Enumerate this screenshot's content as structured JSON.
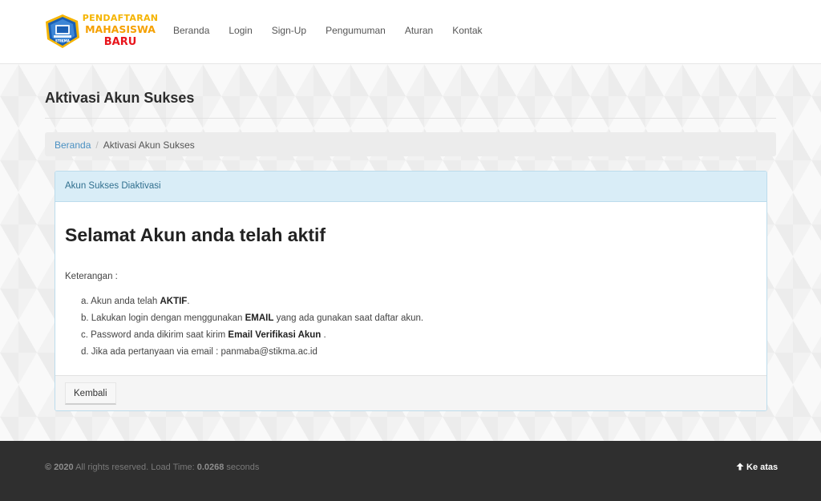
{
  "header": {
    "logo": {
      "line1": "PENDAFTARAN",
      "line2": "MAHASISWA",
      "line3": "BARU",
      "emblem_text": "STIKMA",
      "colors": {
        "gold": "#f5b400",
        "red": "#e8141b",
        "blue": "#1a5fb4"
      }
    },
    "nav": [
      {
        "label": "Beranda"
      },
      {
        "label": "Login"
      },
      {
        "label": "Sign-Up"
      },
      {
        "label": "Pengumuman"
      },
      {
        "label": "Aturan"
      },
      {
        "label": "Kontak"
      }
    ]
  },
  "page": {
    "title": "Aktivasi Akun Sukses",
    "breadcrumb": {
      "home": "Beranda",
      "separator": "/",
      "current": "Aktivasi Akun Sukses"
    }
  },
  "panel": {
    "heading": "Akun Sukses Diaktivasi",
    "headline": "Selamat Akun anda telah aktif",
    "keterangan_label": "Keterangan :",
    "items": [
      {
        "prefix": "a. Akun anda telah ",
        "bold": "AKTIF",
        "suffix": "."
      },
      {
        "prefix": "b. Lakukan login dengan menggunakan ",
        "bold": "EMAIL",
        "suffix": " yang ada gunakan saat daftar akun."
      },
      {
        "prefix": "c. Password anda dikirim saat kirim ",
        "bold": "Email Verifikasi Akun",
        "suffix": " ."
      },
      {
        "prefix": "d. Jika ada pertanyaan via email : panmaba@stikma.ac.id",
        "bold": "",
        "suffix": ""
      }
    ],
    "back_button": "Kembali"
  },
  "footer": {
    "copyright_year": "© 2020",
    "copyright_text": " All rights reserved. Load Time: ",
    "load_time": "0.0268",
    "load_unit": " seconds",
    "to_top_label": "Ke atas",
    "to_top_icon": "arrow-up-icon"
  }
}
